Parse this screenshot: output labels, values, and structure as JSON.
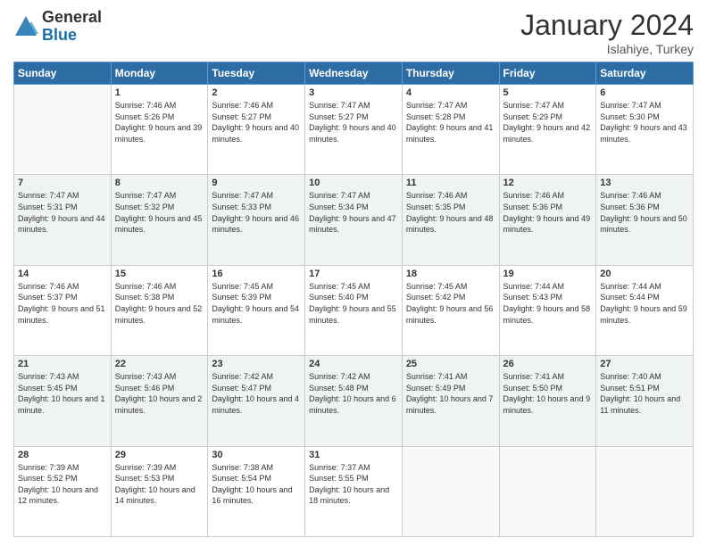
{
  "header": {
    "logo_general": "General",
    "logo_blue": "Blue",
    "month_title": "January 2024",
    "subtitle": "Islahiye, Turkey"
  },
  "weekdays": [
    "Sunday",
    "Monday",
    "Tuesday",
    "Wednesday",
    "Thursday",
    "Friday",
    "Saturday"
  ],
  "weeks": [
    [
      {
        "day": "",
        "sunrise": "",
        "sunset": "",
        "daylight": ""
      },
      {
        "day": "1",
        "sunrise": "Sunrise: 7:46 AM",
        "sunset": "Sunset: 5:26 PM",
        "daylight": "Daylight: 9 hours and 39 minutes."
      },
      {
        "day": "2",
        "sunrise": "Sunrise: 7:46 AM",
        "sunset": "Sunset: 5:27 PM",
        "daylight": "Daylight: 9 hours and 40 minutes."
      },
      {
        "day": "3",
        "sunrise": "Sunrise: 7:47 AM",
        "sunset": "Sunset: 5:27 PM",
        "daylight": "Daylight: 9 hours and 40 minutes."
      },
      {
        "day": "4",
        "sunrise": "Sunrise: 7:47 AM",
        "sunset": "Sunset: 5:28 PM",
        "daylight": "Daylight: 9 hours and 41 minutes."
      },
      {
        "day": "5",
        "sunrise": "Sunrise: 7:47 AM",
        "sunset": "Sunset: 5:29 PM",
        "daylight": "Daylight: 9 hours and 42 minutes."
      },
      {
        "day": "6",
        "sunrise": "Sunrise: 7:47 AM",
        "sunset": "Sunset: 5:30 PM",
        "daylight": "Daylight: 9 hours and 43 minutes."
      }
    ],
    [
      {
        "day": "7",
        "sunrise": "Sunrise: 7:47 AM",
        "sunset": "Sunset: 5:31 PM",
        "daylight": "Daylight: 9 hours and 44 minutes."
      },
      {
        "day": "8",
        "sunrise": "Sunrise: 7:47 AM",
        "sunset": "Sunset: 5:32 PM",
        "daylight": "Daylight: 9 hours and 45 minutes."
      },
      {
        "day": "9",
        "sunrise": "Sunrise: 7:47 AM",
        "sunset": "Sunset: 5:33 PM",
        "daylight": "Daylight: 9 hours and 46 minutes."
      },
      {
        "day": "10",
        "sunrise": "Sunrise: 7:47 AM",
        "sunset": "Sunset: 5:34 PM",
        "daylight": "Daylight: 9 hours and 47 minutes."
      },
      {
        "day": "11",
        "sunrise": "Sunrise: 7:46 AM",
        "sunset": "Sunset: 5:35 PM",
        "daylight": "Daylight: 9 hours and 48 minutes."
      },
      {
        "day": "12",
        "sunrise": "Sunrise: 7:46 AM",
        "sunset": "Sunset: 5:36 PM",
        "daylight": "Daylight: 9 hours and 49 minutes."
      },
      {
        "day": "13",
        "sunrise": "Sunrise: 7:46 AM",
        "sunset": "Sunset: 5:36 PM",
        "daylight": "Daylight: 9 hours and 50 minutes."
      }
    ],
    [
      {
        "day": "14",
        "sunrise": "Sunrise: 7:46 AM",
        "sunset": "Sunset: 5:37 PM",
        "daylight": "Daylight: 9 hours and 51 minutes."
      },
      {
        "day": "15",
        "sunrise": "Sunrise: 7:46 AM",
        "sunset": "Sunset: 5:38 PM",
        "daylight": "Daylight: 9 hours and 52 minutes."
      },
      {
        "day": "16",
        "sunrise": "Sunrise: 7:45 AM",
        "sunset": "Sunset: 5:39 PM",
        "daylight": "Daylight: 9 hours and 54 minutes."
      },
      {
        "day": "17",
        "sunrise": "Sunrise: 7:45 AM",
        "sunset": "Sunset: 5:40 PM",
        "daylight": "Daylight: 9 hours and 55 minutes."
      },
      {
        "day": "18",
        "sunrise": "Sunrise: 7:45 AM",
        "sunset": "Sunset: 5:42 PM",
        "daylight": "Daylight: 9 hours and 56 minutes."
      },
      {
        "day": "19",
        "sunrise": "Sunrise: 7:44 AM",
        "sunset": "Sunset: 5:43 PM",
        "daylight": "Daylight: 9 hours and 58 minutes."
      },
      {
        "day": "20",
        "sunrise": "Sunrise: 7:44 AM",
        "sunset": "Sunset: 5:44 PM",
        "daylight": "Daylight: 9 hours and 59 minutes."
      }
    ],
    [
      {
        "day": "21",
        "sunrise": "Sunrise: 7:43 AM",
        "sunset": "Sunset: 5:45 PM",
        "daylight": "Daylight: 10 hours and 1 minute."
      },
      {
        "day": "22",
        "sunrise": "Sunrise: 7:43 AM",
        "sunset": "Sunset: 5:46 PM",
        "daylight": "Daylight: 10 hours and 2 minutes."
      },
      {
        "day": "23",
        "sunrise": "Sunrise: 7:42 AM",
        "sunset": "Sunset: 5:47 PM",
        "daylight": "Daylight: 10 hours and 4 minutes."
      },
      {
        "day": "24",
        "sunrise": "Sunrise: 7:42 AM",
        "sunset": "Sunset: 5:48 PM",
        "daylight": "Daylight: 10 hours and 6 minutes."
      },
      {
        "day": "25",
        "sunrise": "Sunrise: 7:41 AM",
        "sunset": "Sunset: 5:49 PM",
        "daylight": "Daylight: 10 hours and 7 minutes."
      },
      {
        "day": "26",
        "sunrise": "Sunrise: 7:41 AM",
        "sunset": "Sunset: 5:50 PM",
        "daylight": "Daylight: 10 hours and 9 minutes."
      },
      {
        "day": "27",
        "sunrise": "Sunrise: 7:40 AM",
        "sunset": "Sunset: 5:51 PM",
        "daylight": "Daylight: 10 hours and 11 minutes."
      }
    ],
    [
      {
        "day": "28",
        "sunrise": "Sunrise: 7:39 AM",
        "sunset": "Sunset: 5:52 PM",
        "daylight": "Daylight: 10 hours and 12 minutes."
      },
      {
        "day": "29",
        "sunrise": "Sunrise: 7:39 AM",
        "sunset": "Sunset: 5:53 PM",
        "daylight": "Daylight: 10 hours and 14 minutes."
      },
      {
        "day": "30",
        "sunrise": "Sunrise: 7:38 AM",
        "sunset": "Sunset: 5:54 PM",
        "daylight": "Daylight: 10 hours and 16 minutes."
      },
      {
        "day": "31",
        "sunrise": "Sunrise: 7:37 AM",
        "sunset": "Sunset: 5:55 PM",
        "daylight": "Daylight: 10 hours and 18 minutes."
      },
      {
        "day": "",
        "sunrise": "",
        "sunset": "",
        "daylight": ""
      },
      {
        "day": "",
        "sunrise": "",
        "sunset": "",
        "daylight": ""
      },
      {
        "day": "",
        "sunrise": "",
        "sunset": "",
        "daylight": ""
      }
    ]
  ]
}
